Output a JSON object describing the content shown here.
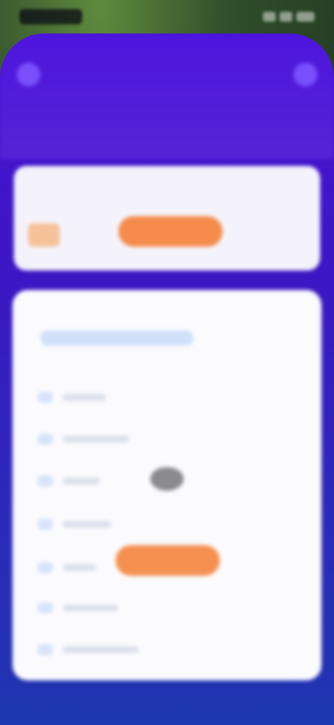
{
  "status_bar": {
    "time": "",
    "icons": [
      "signal-icon",
      "wifi-icon",
      "battery-icon"
    ]
  },
  "header": {
    "title": "",
    "subtitle": "",
    "left_icon": "menu-icon",
    "right_icon": "profile-icon"
  },
  "top_card": {
    "caption": "",
    "badge_icon": "gift-icon",
    "button_label": ""
  },
  "main_card": {
    "label": "",
    "search_placeholder": "",
    "rows": [
      {
        "icon": "list-icon",
        "text": ""
      },
      {
        "icon": "list-icon",
        "text": ""
      },
      {
        "icon": "list-icon",
        "text": ""
      },
      {
        "icon": "list-icon",
        "text": ""
      },
      {
        "icon": "list-icon",
        "text": ""
      },
      {
        "icon": "list-icon",
        "text": ""
      },
      {
        "icon": "list-icon",
        "text": ""
      }
    ],
    "avatar_label": "",
    "button_label": ""
  },
  "colors": {
    "primary": "#4a12d4",
    "accent": "#f58c4c",
    "card": "#fbfbfe"
  }
}
